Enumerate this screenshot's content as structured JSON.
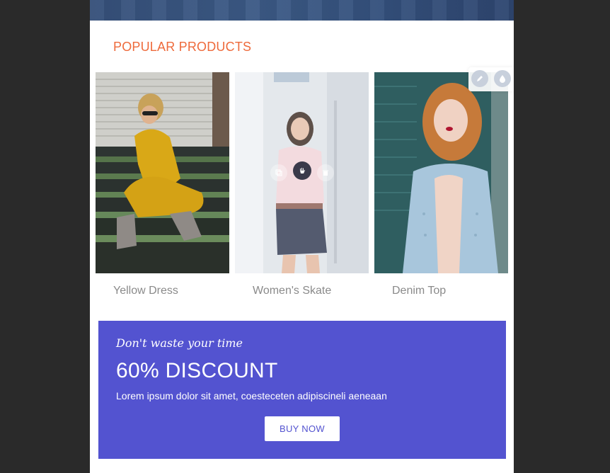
{
  "section": {
    "title": "POPULAR PRODUCTS"
  },
  "products": [
    {
      "name": "Yellow Dress",
      "image": "woman-yellow-dress-photo"
    },
    {
      "name": "Women's Skate",
      "image": "woman-skate-outfit-photo"
    },
    {
      "name": "Denim Top",
      "image": "woman-denim-top-photo"
    }
  ],
  "block_tools": {
    "edit_icon": "pencil-icon",
    "drop_icon": "droplet-icon"
  },
  "hover_tools": {
    "copy_icon": "copy-icon",
    "move_icon": "hand-move-icon",
    "delete_icon": "trash-icon"
  },
  "promo": {
    "tagline": "Don't waste your time",
    "headline": "60% DISCOUNT",
    "body": "Lorem ipsum dolor sit amet, coesteceten adipiscineli aeneaan",
    "button_label": "BUY NOW",
    "background_color": "#5353d0"
  },
  "colors": {
    "accent": "#ee6a3b",
    "backdrop": "#2a2a2a"
  }
}
